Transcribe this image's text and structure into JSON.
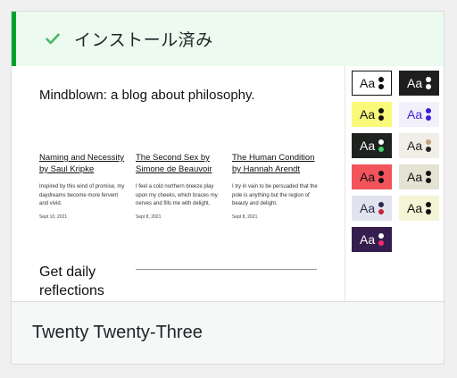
{
  "notice": {
    "text": "インストール済み",
    "icon": "check-icon",
    "accent": "#00a32a"
  },
  "preview": {
    "site_title": "Mindblown: a blog about philosophy.",
    "posts": [
      {
        "title": "Naming and Necessity by Saul Kripke",
        "excerpt": "Inspired by this wind of promise, my daydreams become more fervent and vivid.",
        "date": "Sept 10, 2021"
      },
      {
        "title": "The Second Sex by Simone de Beauvoir",
        "excerpt": "I feel a cold northern breeze play upon my cheeks, which braces my nerves and fills me with delight.",
        "date": "Sept 8, 2021"
      },
      {
        "title": "The Human Condition by Hannah Arendt",
        "excerpt": "I try in vain to be persuaded that the pole is anything but the region of beauty and delight.",
        "date": "Sept 8, 2021"
      }
    ],
    "cta_text": "Get daily reflections",
    "style_variations": [
      {
        "label": "Aa",
        "bg": "#ffffff",
        "text": "#111111",
        "dot1": "#111111",
        "dot2": "#111111",
        "border": "#111111"
      },
      {
        "label": "Aa",
        "bg": "#1e1e1e",
        "text": "#ffffff",
        "dot1": "#ffffff",
        "dot2": "#ffffff",
        "border": "#1e1e1e"
      },
      {
        "label": "Aa",
        "bg": "#f9f97a",
        "text": "#111111",
        "dot1": "#111111",
        "dot2": "#111111",
        "border": "#f9f97a"
      },
      {
        "label": "Aa",
        "bg": "#f2f1fb",
        "text": "#3e1ddb",
        "dot1": "#3e1ddb",
        "dot2": "#3e1ddb",
        "border": "#f2f1fb"
      },
      {
        "label": "Aa",
        "bg": "#1f2320",
        "text": "#ffffff",
        "dot1": "#ffffff",
        "dot2": "#3fd46d",
        "border": "#1f2320"
      },
      {
        "label": "Aa",
        "bg": "#f1ede7",
        "text": "#222222",
        "dot1": "#c5a47a",
        "dot2": "#222222",
        "border": "#f1ede7"
      },
      {
        "label": "Aa",
        "bg": "#f2545b",
        "text": "#111111",
        "dot1": "#111111",
        "dot2": "#111111",
        "border": "#f2545b"
      },
      {
        "label": "Aa",
        "bg": "#e3e2d3",
        "text": "#111111",
        "dot1": "#111111",
        "dot2": "#111111",
        "border": "#e3e2d3"
      },
      {
        "label": "Aa",
        "bg": "#e1e3ee",
        "text": "#2a2a4a",
        "dot1": "#2a2a4a",
        "dot2": "#c5243a",
        "border": "#e1e3ee"
      },
      {
        "label": "Aa",
        "bg": "#f4f4d6",
        "text": "#111111",
        "dot1": "#111111",
        "dot2": "#111111",
        "border": "#f4f4d6"
      },
      {
        "label": "Aa",
        "bg": "#341e4d",
        "text": "#ffffff",
        "dot1": "#ffffff",
        "dot2": "#ff2a73",
        "border": "#341e4d"
      }
    ]
  },
  "footer": {
    "theme_name": "Twenty Twenty-Three"
  }
}
